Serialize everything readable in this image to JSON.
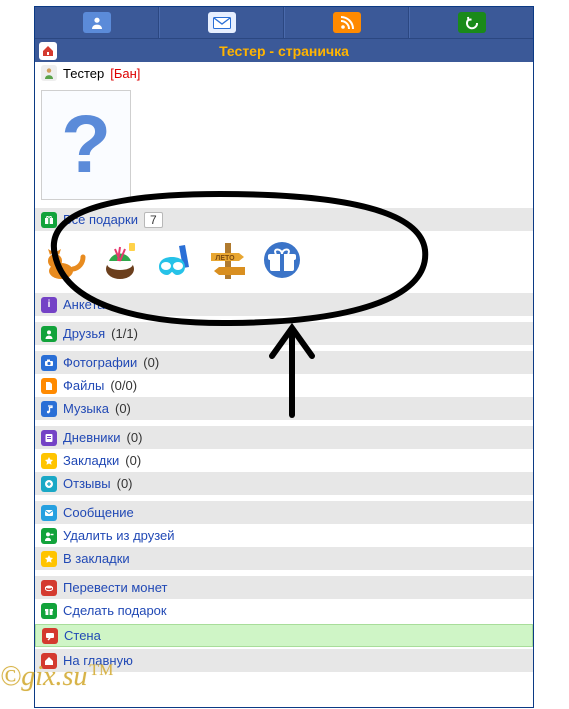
{
  "title": "Тестер - страничка",
  "user": {
    "name": "Тестер",
    "status": "[Бан]",
    "avatar_glyph": "?"
  },
  "gifts_header": {
    "label": "Все подарки",
    "count": "7"
  },
  "gift_icons": [
    "cat",
    "coconut",
    "snorkel",
    "summer-sign",
    "gift-box-round"
  ],
  "anketa": "Анкета",
  "friends": {
    "label": "Друзья",
    "count": "(1/1)"
  },
  "photos": {
    "label": "Фотографии",
    "count": "(0)"
  },
  "files": {
    "label": "Файлы",
    "count": "(0/0)"
  },
  "music": {
    "label": "Музыка",
    "count": "(0)"
  },
  "diaries": {
    "label": "Дневники",
    "count": "(0)"
  },
  "bookmarks": {
    "label": "Закладки",
    "count": "(0)"
  },
  "reviews": {
    "label": "Отзывы",
    "count": "(0)"
  },
  "message": "Сообщение",
  "remove_friend": "Удалить из друзей",
  "to_bookmarks": "В закладки",
  "transfer": "Перевести монет",
  "make_gift": "Сделать подарок",
  "wall": "Стена",
  "home": "На главную",
  "watermark": {
    "text": "©gix.su",
    "tm": "TM"
  }
}
